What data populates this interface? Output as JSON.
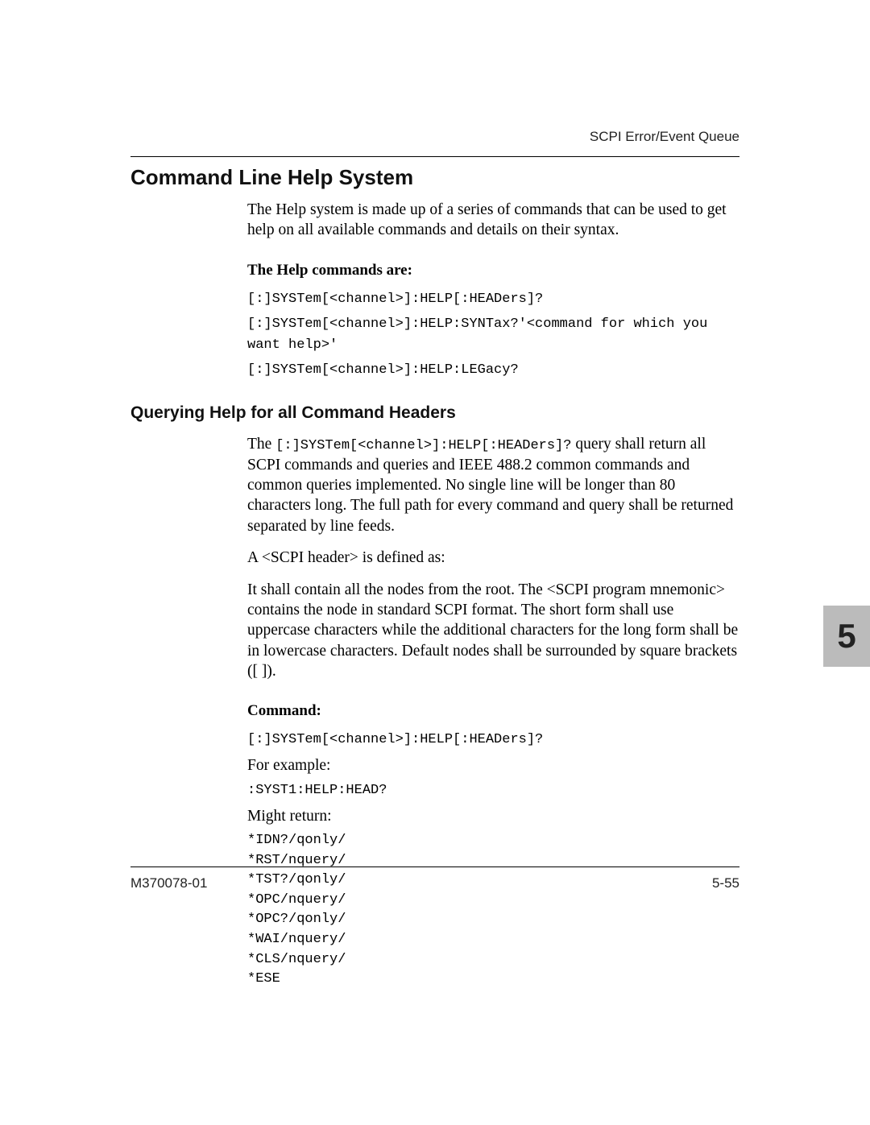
{
  "header": {
    "right_text": "SCPI Error/Event Queue"
  },
  "section": {
    "title": "Command Line Help System",
    "intro": "The Help system is made up of a series of commands that can be used to get help on all available commands and details on their syntax."
  },
  "help_commands": {
    "label": "The Help commands are:",
    "lines": [
      "[:]SYSTem[<channel>]:HELP[:HEADers]?",
      "[:]SYSTem[<channel>]:HELP:SYNTax?'<command for which you want help>'",
      "[:]SYSTem[<channel>]:HELP:LEGacy?"
    ]
  },
  "subsection": {
    "title": "Querying Help for all Command Headers",
    "para1_prefix": "The ",
    "para1_code": "[:]SYSTem[<channel>]:HELP[:HEADers]?",
    "para1_suffix": " query shall return all SCPI commands and queries and IEEE 488.2 common commands and common queries implemented. No single line will be longer than 80 characters long. The full path for every command and query shall be returned separated by line feeds.",
    "para2": "A <SCPI header> is defined as:",
    "para3": "It shall contain all the nodes from the root. The <SCPI program mnemonic> contains the node in standard SCPI format. The short form shall use uppercase characters while the additional characters for the long form shall be in lowercase characters. Default nodes shall be surrounded by square brackets ([ ])."
  },
  "command_section": {
    "label": "Command:",
    "command_line": "[:]SYSTem[<channel>]:HELP[:HEADers]?",
    "for_example": "For example:",
    "example_code": ":SYST1:HELP:HEAD?",
    "might_return": "Might return:",
    "return_lines": "*IDN?/qonly/\n*RST/nquery/\n*TST?/qonly/\n*OPC/nquery/\n*OPC?/qonly/\n*WAI/nquery/\n*CLS/nquery/\n*ESE"
  },
  "chapter_tab": "5",
  "footer": {
    "left": "M370078-01",
    "right": "5-55"
  }
}
